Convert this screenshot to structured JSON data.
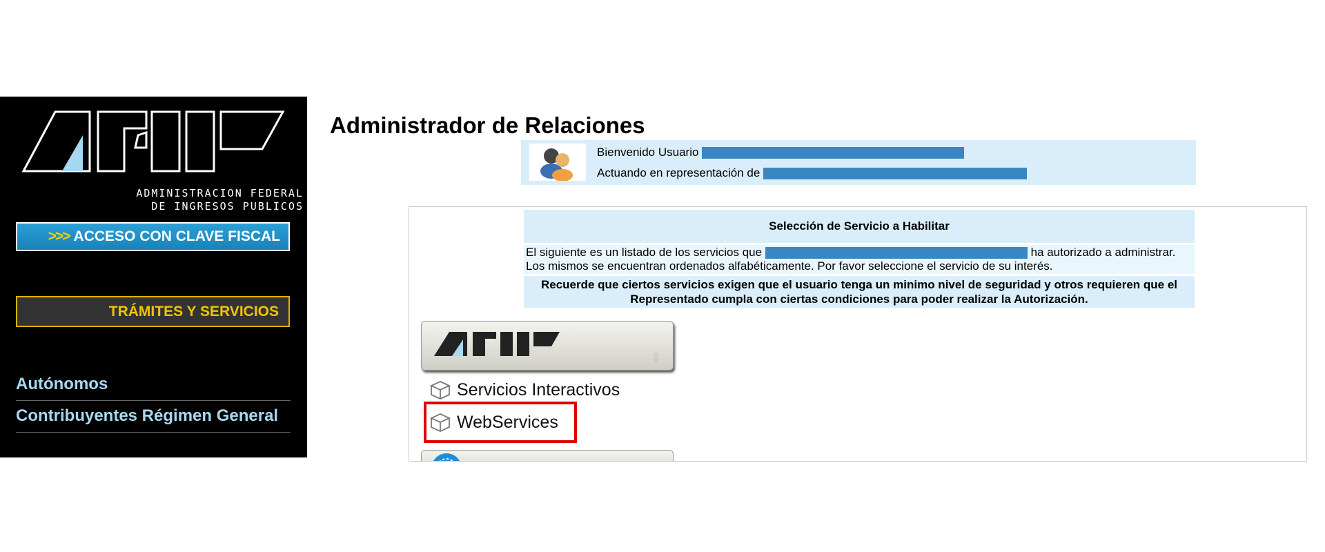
{
  "sidebar": {
    "logo_line1": "ADMINISTRACION FEDERAL",
    "logo_line2": "DE INGRESOS PUBLICOS",
    "clave_arrows": ">>>",
    "clave_label": "ACCESO CON CLAVE FISCAL",
    "tramites_label": "TRÁMITES Y SERVICIOS",
    "nav": [
      {
        "label": "Autónomos"
      },
      {
        "label": "Contribuyentes Régimen General"
      }
    ]
  },
  "main": {
    "title": "Administrador de Relaciones",
    "welcome": {
      "user_prefix": "Bienvenido Usuario",
      "rep_prefix": "Actuando en representación de"
    },
    "selection": {
      "header": "Selección de Servicio a Habilitar",
      "desc_before": "El siguiente es un listado de los servicios que",
      "desc_after": "ha autorizado a administrar. Los mismos se encuentran ordenados alfabéticamente. Por favor seleccione el servicio de su interés.",
      "note": "Recuerde que ciertos servicios exigen que el usuario tenga un minimo nivel de seguridad y otros requieren que el Representado cumpla con ciertas condiciones para poder realizar la Autorización."
    },
    "services": [
      {
        "label": "Servicios Interactivos",
        "icon": "box-icon"
      },
      {
        "label": "WebServices",
        "icon": "box-icon"
      }
    ]
  },
  "colors": {
    "sidebar_bg": "#000000",
    "clave_blue": "#1a82b8",
    "tramites_gold": "#f3c400",
    "panel_blue": "#d9eefa",
    "redaction_blue": "#3a86c2",
    "highlight_red": "#e00000"
  }
}
